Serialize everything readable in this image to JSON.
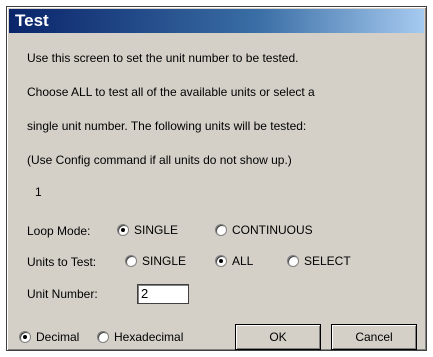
{
  "dialog": {
    "title": "Test",
    "lines": [
      "Use this screen to set the unit number to be tested.",
      "Choose ALL to test all of the available units or select a",
      "single unit number.  The following units will be tested:",
      "(Use Config command if all units do not show up.)",
      "1"
    ]
  },
  "loop_mode": {
    "label": "Loop Mode:",
    "options": [
      {
        "label": "SINGLE",
        "checked": true
      },
      {
        "label": "CONTINUOUS",
        "checked": false
      }
    ]
  },
  "units_to_test": {
    "label": "Units to Test:",
    "options": [
      {
        "label": "SINGLE",
        "checked": false
      },
      {
        "label": "ALL",
        "checked": true
      },
      {
        "label": "SELECT",
        "checked": false
      }
    ]
  },
  "unit_number": {
    "label": "Unit Number:",
    "value": "2"
  },
  "base": {
    "options": [
      {
        "label": "Decimal",
        "checked": true
      },
      {
        "label": "Hexadecimal",
        "checked": false
      }
    ]
  },
  "buttons": {
    "ok": "OK",
    "cancel": "Cancel"
  }
}
